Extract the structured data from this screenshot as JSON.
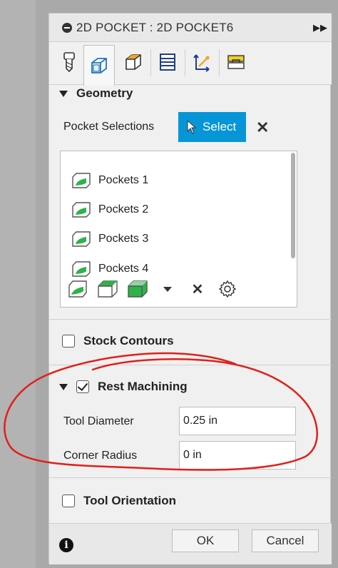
{
  "dialog": {
    "title": "2D POCKET : 2D POCKET6",
    "tabs": [
      {
        "name": "tool-icon"
      },
      {
        "name": "geometry-icon",
        "active": true
      },
      {
        "name": "heights-icon"
      },
      {
        "name": "passes-icon"
      },
      {
        "name": "linking-icon"
      },
      {
        "name": "post-process-icon"
      }
    ]
  },
  "geometry": {
    "heading": "Geometry",
    "pocket_selections_label": "Pocket Selections",
    "select_label": "Select",
    "items": [
      "Pockets 1",
      "Pockets 2",
      "Pockets 3",
      "Pockets 4"
    ]
  },
  "stock_contours": {
    "label": "Stock Contours",
    "checked": false
  },
  "rest_machining": {
    "label": "Rest Machining",
    "checked": true,
    "tool_diameter_label": "Tool Diameter",
    "tool_diameter_value": "0.25 in",
    "corner_radius_label": "Corner Radius",
    "corner_radius_value": "0 in"
  },
  "tool_orientation": {
    "label": "Tool Orientation",
    "checked": false
  },
  "footer": {
    "ok_label": "OK",
    "cancel_label": "Cancel"
  },
  "colors": {
    "accent": "#0696d7",
    "annotation": "#e0201a",
    "pocket_green": "#2db34a"
  }
}
